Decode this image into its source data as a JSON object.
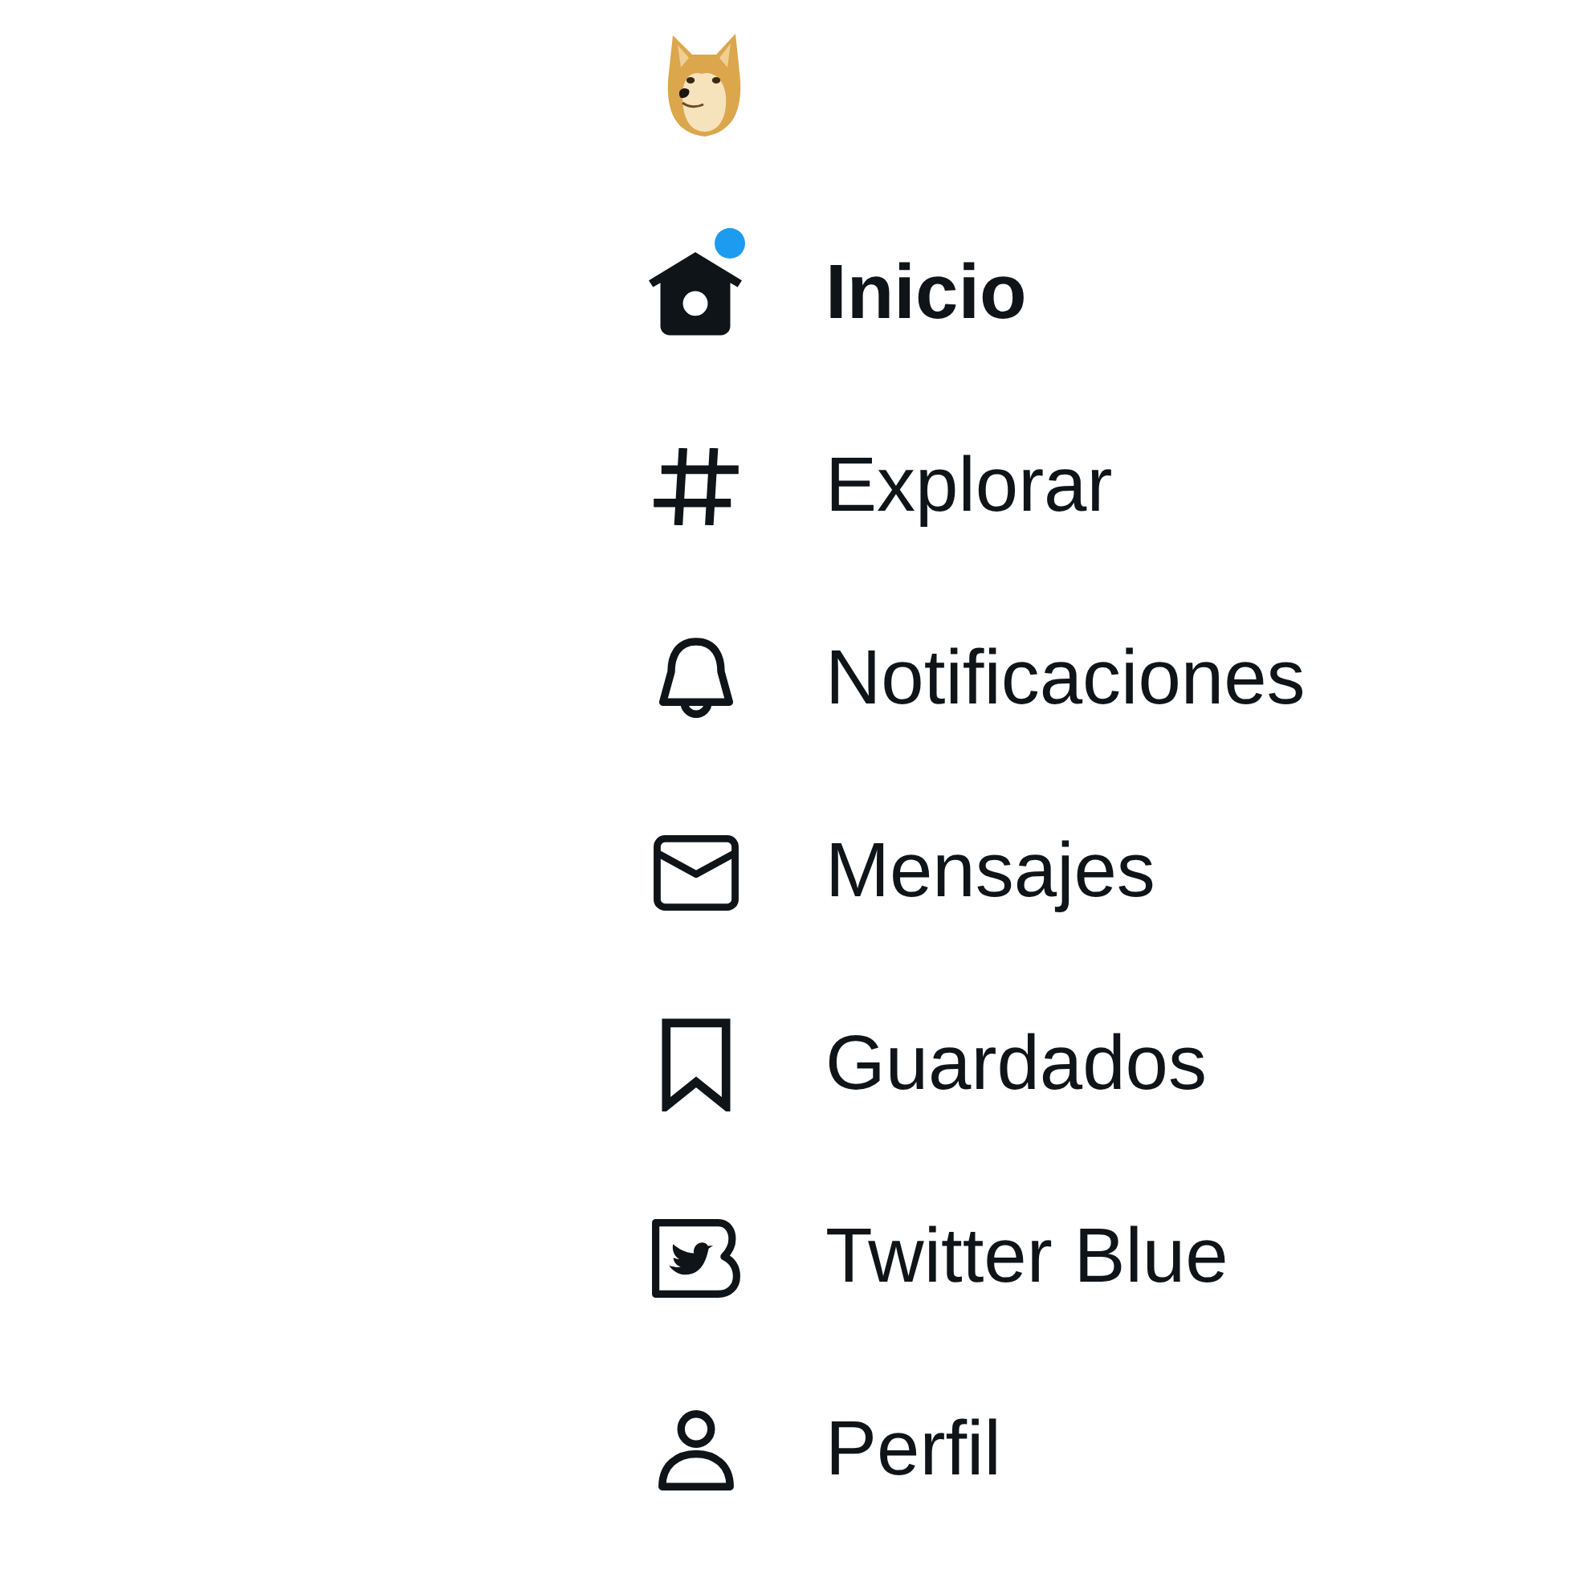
{
  "sidebar": {
    "items": [
      {
        "label": "Inicio",
        "selected": true,
        "notification": true
      },
      {
        "label": "Explorar",
        "selected": false,
        "notification": false
      },
      {
        "label": "Notificaciones",
        "selected": false,
        "notification": false
      },
      {
        "label": "Mensajes",
        "selected": false,
        "notification": false
      },
      {
        "label": "Guardados",
        "selected": false,
        "notification": false
      },
      {
        "label": "Twitter Blue",
        "selected": false,
        "notification": false
      },
      {
        "label": "Perfil",
        "selected": false,
        "notification": false
      }
    ]
  }
}
